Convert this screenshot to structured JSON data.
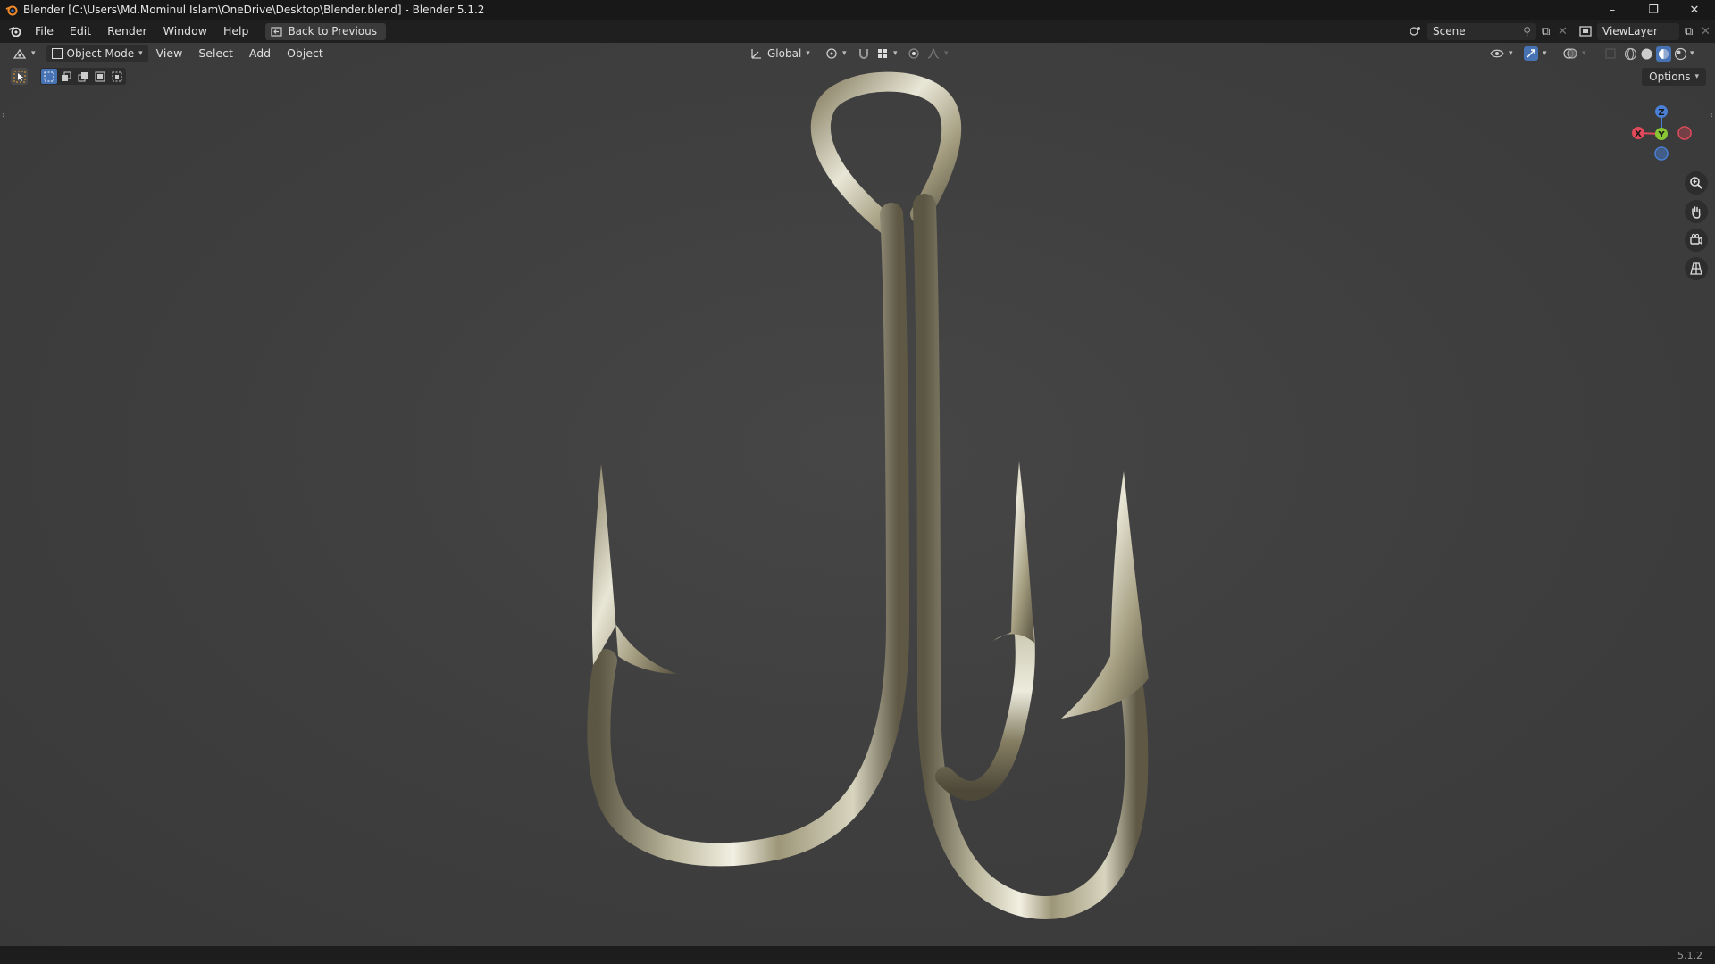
{
  "window": {
    "title": "Blender [C:\\Users\\Md.Mominul Islam\\OneDrive\\Desktop\\Blender.blend] - Blender 5.1.2",
    "controls": [
      "minimize",
      "restore",
      "close"
    ]
  },
  "menu": {
    "items": [
      "File",
      "Edit",
      "Render",
      "Window",
      "Help"
    ],
    "back_button": "Back to Previous"
  },
  "top_right": {
    "scene": "Scene",
    "view_layer": "ViewLayer"
  },
  "viewport_header": {
    "mode": "Object Mode",
    "menus": [
      "View",
      "Select",
      "Add",
      "Object"
    ],
    "transform_orientation": "Global"
  },
  "toolbar": {
    "options_label": "Options"
  },
  "gizmo": {
    "labels": {
      "z": "Z",
      "y": "Y",
      "x": "X"
    },
    "colors": {
      "x": "#e04a5a",
      "y": "#8ac634",
      "z": "#4a7fd6"
    }
  },
  "scene_object": {
    "icon": "double-fishing-hook",
    "material_colors": [
      "#c9c7ad",
      "#8a8266",
      "#e8e6d6",
      "#5c5744"
    ]
  },
  "status": {
    "version": "5.1.2"
  },
  "colors": {
    "accent": "#4772b3",
    "viewport_bg": "#3f3f3f",
    "header_bg": "#1f1f1f"
  }
}
